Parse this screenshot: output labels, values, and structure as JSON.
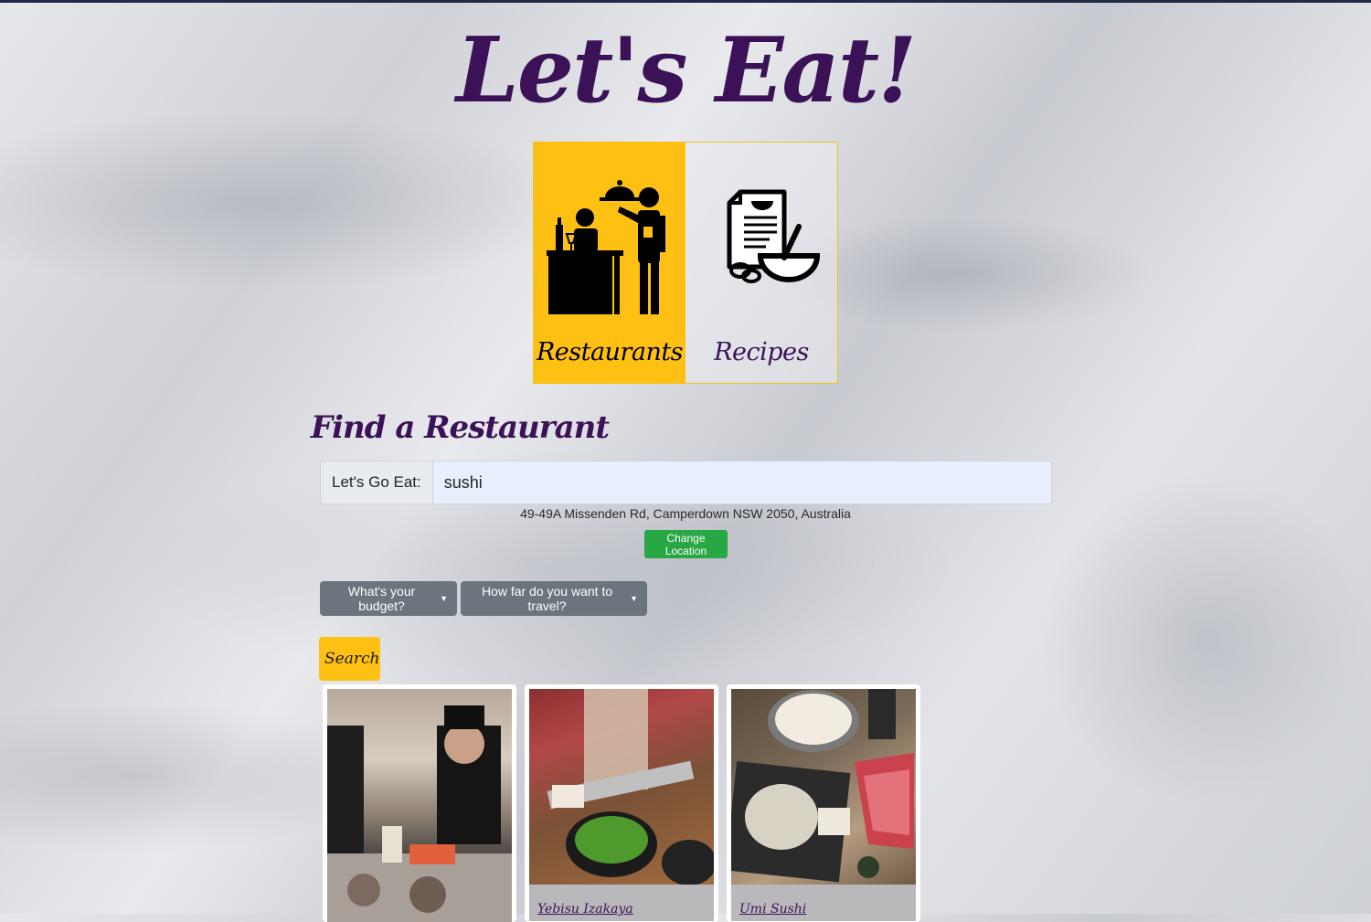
{
  "app": {
    "logo_text": "Let's Eat!"
  },
  "mode_tiles": [
    {
      "label": "Restaurants",
      "icon": "waiter-serving-icon",
      "active": true
    },
    {
      "label": "Recipes",
      "icon": "recipe-bowl-icon",
      "active": false
    }
  ],
  "finder": {
    "title": "Find a Restaurant",
    "search_prefix": "Let's Go Eat:",
    "search_value": "sushi",
    "location": "49-49A Missenden Rd, Camperdown NSW 2050, Australia",
    "change_location_label": "Change Location",
    "budget_dropdown_label": "What's your budget?",
    "travel_dropdown_label": "How far do you want to travel?",
    "search_button_label": "Search"
  },
  "results": [
    {
      "name": "",
      "photo": "sushi chefs at counter"
    },
    {
      "name": "Yebisu Izakaya",
      "photo": "edamame with grater"
    },
    {
      "name": "Umi Sushi",
      "photo": "hotpot with wagyu and vegetables"
    }
  ],
  "colors": {
    "accent_yellow": "#fec012",
    "brand_purple": "#3b1257",
    "success_green": "#28a745",
    "dropdown_gray": "#6c757d"
  }
}
